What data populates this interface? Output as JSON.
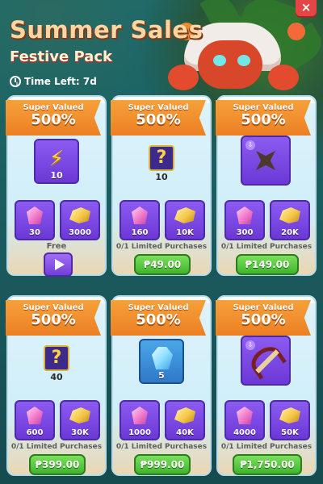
{
  "header": {
    "title": "Summer Sales",
    "subtitle": "Festive Pack",
    "time_left": "Time Left: 7d",
    "close_label": "×"
  },
  "colors": {
    "ribbon": "#ec7f23",
    "price_button": "#3fb42e",
    "item_tile": "#6b38d6",
    "title": "#ffd5a1"
  },
  "cards": [
    {
      "ribbon_label": "Super Valued",
      "ribbon_value": "500%",
      "main_icon": "lightning-icon",
      "main_qty": "10",
      "gem_qty": "30",
      "gold_qty": "3000",
      "footer": "Free",
      "action": "play"
    },
    {
      "ribbon_label": "Super Valued",
      "ribbon_value": "500%",
      "main_icon": "mystery-box-icon",
      "main_qty": "10",
      "gem_qty": "160",
      "gold_qty": "10K",
      "footer": "0/1 Limited Purchases",
      "price": "₱49.00"
    },
    {
      "ribbon_label": "Super Valued",
      "ribbon_value": "500%",
      "main_icon": "shuriken-icon",
      "main_qty": "",
      "gem_qty": "300",
      "gold_qty": "20K",
      "footer": "0/1 Limited Purchases",
      "price": "₱149.00"
    },
    {
      "ribbon_label": "Super Valued",
      "ribbon_value": "500%",
      "main_icon": "mystery-box-icon",
      "main_qty": "40",
      "gem_qty": "600",
      "gold_qty": "30K",
      "footer": "0/1 Limited Purchases",
      "price": "₱399.00"
    },
    {
      "ribbon_label": "Super Valued",
      "ribbon_value": "500%",
      "main_icon": "blue-crystal-icon",
      "main_qty": "5",
      "gem_qty": "1000",
      "gold_qty": "40K",
      "footer": "0/1 Limited Purchases",
      "price": "₱999.00"
    },
    {
      "ribbon_label": "Super Valued",
      "ribbon_value": "500%",
      "main_icon": "crossbow-icon",
      "main_qty": "",
      "gem_qty": "4000",
      "gold_qty": "50K",
      "footer": "0/1 Limited Purchases",
      "price": "₱1,750.00"
    }
  ]
}
